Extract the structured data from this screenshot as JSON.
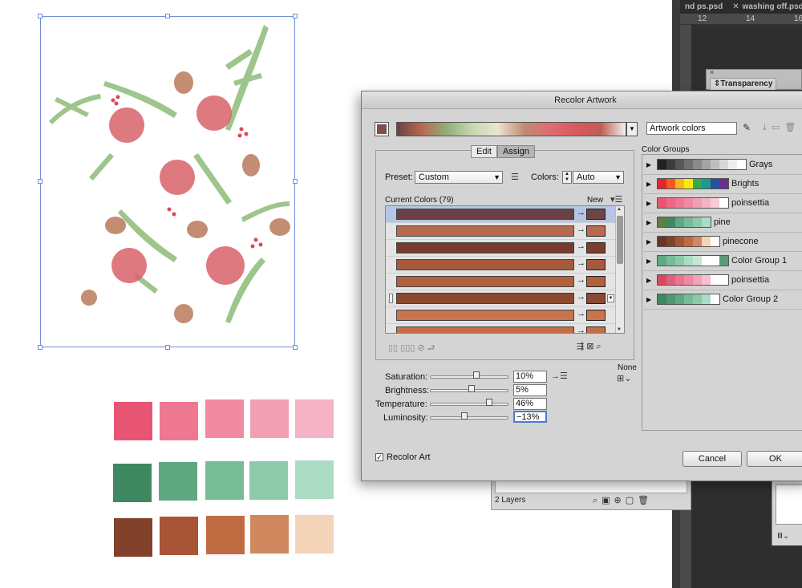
{
  "tabs": [
    {
      "label": "nd ps.psd",
      "has_close": false
    },
    {
      "label": "washing off.psd",
      "has_close": true
    }
  ],
  "ruler": {
    "labels": [
      "12",
      "14",
      "16"
    ]
  },
  "transparency_panel": {
    "tab_label": "Transparency"
  },
  "layers_panel": {
    "count": "2 Layers"
  },
  "swatch_rows": [
    [
      "#e85572",
      "#ee7891",
      "#f28ba2",
      "#f29fb4",
      "#f4b4c5"
    ],
    [
      "#3f8760",
      "#5fa882",
      "#78bb97",
      "#8dc9ab",
      "#acdcc4"
    ],
    [
      "#82412a",
      "#a75534",
      "#bf6c42",
      "#d0895e",
      "#f3d4b8"
    ]
  ],
  "dialog": {
    "title": "Recolor Artwork",
    "artwork_name": "Artwork colors",
    "edit_tab": "Edit",
    "assign_tab": "Assign",
    "preset_label": "Preset:",
    "preset_value": "Custom",
    "colors_label": "Colors:",
    "colors_value": "Auto",
    "current_colors_label": "Current Colors (79)",
    "new_label": "New",
    "none_label": "None",
    "rows": [
      {
        "current": "#6a4144",
        "new": "#6f4542",
        "selected": true
      },
      {
        "current": "#b86a4f",
        "new": "#b86a4f"
      },
      {
        "current": "#783a2c",
        "new": "#7a3d2e"
      },
      {
        "current": "#a65a3c",
        "new": "#a65a3c"
      },
      {
        "current": "#b3603f",
        "new": "#b3603f"
      },
      {
        "current": "#8a4a30",
        "new": "#8a4a30",
        "handle": true
      },
      {
        "current": "#c77550",
        "new": "#c77550"
      },
      {
        "current": "#c66e46",
        "new": "#c66e46"
      }
    ],
    "sliders": [
      {
        "label": "Saturation:",
        "value": "10%",
        "pos": 0.58
      },
      {
        "label": "Brightness:",
        "value": "5%",
        "pos": 0.52
      },
      {
        "label": "Temperature:",
        "value": "46%",
        "pos": 0.74
      },
      {
        "label": "Luminosity:",
        "value": "−13%",
        "pos": 0.43
      }
    ],
    "color_groups_label": "Color Groups",
    "groups": [
      {
        "name": "Grays",
        "chips": [
          "#222222",
          "#3c3c3c",
          "#575757",
          "#707070",
          "#8a8a8a",
          "#a4a4a4",
          "#bebebe",
          "#d8d8d8",
          "#ededed",
          "#ffffff"
        ]
      },
      {
        "name": "Brights",
        "chips": [
          "#e3262d",
          "#f25a22",
          "#f8b51c",
          "#f7eb0d",
          "#37a94a",
          "#1d9a8a",
          "#2a4fa1",
          "#6c2f8f"
        ]
      },
      {
        "name": "poinsettia",
        "chips": [
          "#e85572",
          "#ec6982",
          "#ee7891",
          "#f08aa0",
          "#f29fb4",
          "#f4b4c5",
          "#f8c9d6",
          "#ffffff"
        ]
      },
      {
        "name": "pine",
        "chips": [
          "#5f7e44",
          "#3f8760",
          "#5fa882",
          "#78bb97",
          "#8dc9ab",
          "#acdcc4"
        ]
      },
      {
        "name": "pinecone",
        "chips": [
          "#6b3522",
          "#82412a",
          "#a75534",
          "#bf6c42",
          "#d0895e",
          "#f3d4b8",
          "#ffffff"
        ]
      },
      {
        "name": "Color Group 1",
        "chips": [
          "#5fa882",
          "#78bb97",
          "#8dc9ab",
          "#acdcc4",
          "#c4e6d4",
          "#ffffff",
          "#ffffff",
          "#5a9a78"
        ]
      },
      {
        "name": "poinsettia",
        "chips": [
          "#d8485f",
          "#e0607a",
          "#e87691",
          "#ee8aa1",
          "#f2a3b7",
          "#f7c0cf",
          "#ffffff",
          "#ffffff"
        ]
      },
      {
        "name": "Color Group 2",
        "chips": [
          "#3f8760",
          "#4f9870",
          "#5fa882",
          "#78bb97",
          "#8dc9ab",
          "#acdcc4",
          "#ffffff"
        ]
      }
    ],
    "recolor_art_label": "Recolor Art",
    "recolor_art_checked": true,
    "cancel_label": "Cancel",
    "ok_label": "OK",
    "check_glyph": "✓"
  }
}
